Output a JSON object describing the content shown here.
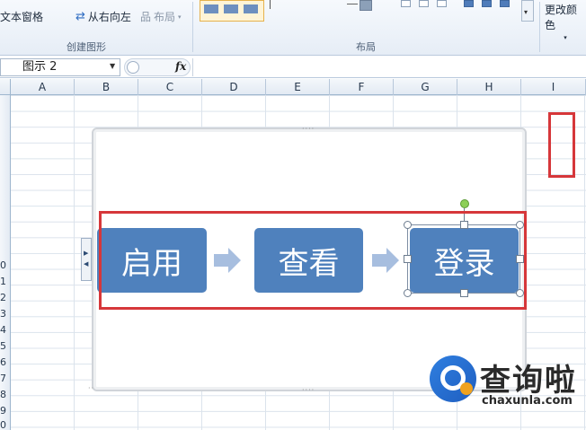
{
  "ribbon": {
    "text_pane_label": "文本窗格",
    "right_to_left_label": "从右向左",
    "layout_button_label": "布局",
    "create_graphic_group": "创建图形",
    "layouts_group": "布局",
    "change_colors_label": "更改颜色"
  },
  "formula_bar": {
    "name_box_value": "图示 2",
    "fx_label": "fx",
    "formula_value": ""
  },
  "grid": {
    "columns": [
      "A",
      "B",
      "C",
      "D",
      "E",
      "F",
      "G",
      "H",
      "I"
    ],
    "row_numbers": [
      "0",
      "1",
      "2",
      "3",
      "4",
      "5",
      "6",
      "7",
      "8",
      "9",
      "0"
    ]
  },
  "smartart": {
    "boxes": [
      "启用",
      "查看",
      "登录"
    ],
    "box_color": "#4f81bd",
    "arrow_color": "#a7bedf"
  },
  "annotation": {
    "highlight_color": "#d6373a"
  },
  "watermark": {
    "title": "查询啦",
    "url": "chaxunla.com"
  }
}
